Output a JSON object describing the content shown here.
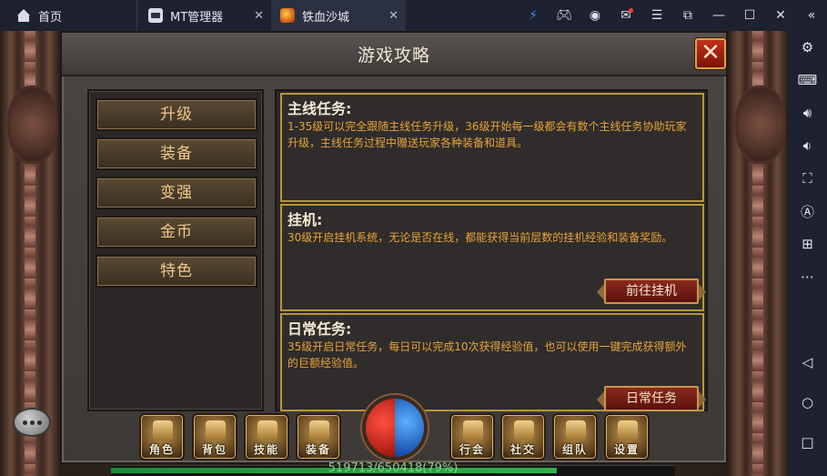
{
  "emulator": {
    "tabs": [
      {
        "label": "首页"
      },
      {
        "label": "MT管理器"
      },
      {
        "label": "铁血沙城"
      }
    ],
    "top_icons": [
      "bolt-icon",
      "gamepad-icon",
      "account-icon",
      "mail-icon",
      "menu-icon",
      "restore-icon",
      "minimize-icon",
      "maximize-icon",
      "close-icon",
      "collapse-icon"
    ],
    "side_icons": [
      "settings-icon",
      "keyboard-icon",
      "volume-up-icon",
      "volume-down-icon",
      "screenshot-icon",
      "auto-icon",
      "add-window-icon",
      "more-icon",
      "back-icon",
      "home-icon",
      "recent-icon"
    ]
  },
  "game": {
    "panel_title": "游戏攻略",
    "menu": [
      {
        "label": "升级"
      },
      {
        "label": "装备"
      },
      {
        "label": "变强"
      },
      {
        "label": "金币"
      },
      {
        "label": "特色"
      }
    ],
    "sections": [
      {
        "title": "主线任务:",
        "body": "1-35级可以完全跟随主线任务升级，36级开始每一级都会有数个主线任务协助玩家升级，主线任务过程中赠送玩家各种装备和道具。"
      },
      {
        "title": "挂机:",
        "body": "30级开启挂机系统，无论是否在线，都能获得当前层数的挂机经验和装备奖励。",
        "button": "前往挂机"
      },
      {
        "title": "日常任务:",
        "body": "35级开启日常任务，每日可以完成10次获得经验值，也可以使用一键完成获得额外的巨额经验值。",
        "button": "日常任务"
      }
    ],
    "hud_buttons": [
      {
        "label": "角色"
      },
      {
        "label": "背包"
      },
      {
        "label": "技能"
      },
      {
        "label": "装备"
      },
      {
        "label": "行会"
      },
      {
        "label": "社交"
      },
      {
        "label": "组队"
      },
      {
        "label": "设置"
      }
    ],
    "xp": {
      "text": "519713/650418(79%)",
      "fraction": 0.79
    }
  },
  "colors": {
    "menu_text": "#f0c98a",
    "section_body": "#e8a43a",
    "section_border": "#b8963a",
    "xp_bar": "#2fb04a"
  }
}
